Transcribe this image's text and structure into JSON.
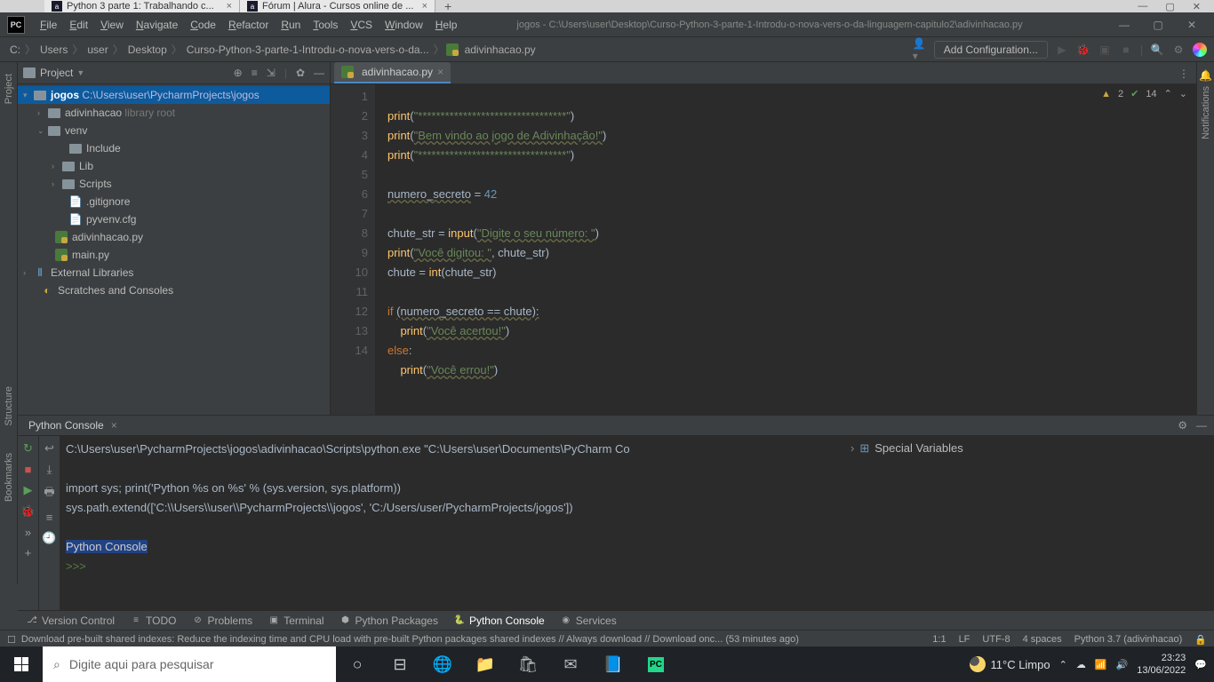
{
  "browserTabs": [
    {
      "icon": "a",
      "title": "Python 3 parte 1: Trabalhando c..."
    },
    {
      "icon": "a",
      "title": "Fórum | Alura - Cursos online de ..."
    }
  ],
  "menu": [
    "File",
    "Edit",
    "View",
    "Navigate",
    "Code",
    "Refactor",
    "Run",
    "Tools",
    "VCS",
    "Window",
    "Help"
  ],
  "windowTitle": "jogos - C:\\Users\\user\\Desktop\\Curso-Python-3-parte-1-Introdu-o-nova-vers-o-da-linguagem-capitulo2\\adivinhacao.py",
  "breadcrumbs": [
    "C:",
    "Users",
    "user",
    "Desktop",
    "Curso-Python-3-parte-1-Introdu-o-nova-vers-o-da..."
  ],
  "breadcrumbFile": "adivinhacao.py",
  "addConfig": "Add Configuration...",
  "projectPanel": {
    "title": "Project",
    "root": {
      "name": "jogos",
      "path": "C:\\Users\\user\\PycharmProjects\\jogos"
    },
    "items": [
      {
        "indent": 1,
        "chev": ">",
        "icon": "folder",
        "name": "adivinhacao",
        "suffix": "library root"
      },
      {
        "indent": 1,
        "chev": "v",
        "icon": "folder",
        "name": "venv"
      },
      {
        "indent": 2,
        "chev": "",
        "icon": "folder",
        "name": "Include"
      },
      {
        "indent": 2,
        "chev": ">",
        "icon": "folder",
        "name": "Lib"
      },
      {
        "indent": 2,
        "chev": ">",
        "icon": "folder",
        "name": "Scripts"
      },
      {
        "indent": 2,
        "chev": "",
        "icon": "file",
        "name": ".gitignore"
      },
      {
        "indent": 2,
        "chev": "",
        "icon": "file",
        "name": "pyvenv.cfg"
      },
      {
        "indent": 1,
        "chev": "",
        "icon": "py",
        "name": "adivinhacao.py"
      },
      {
        "indent": 1,
        "chev": "",
        "icon": "py",
        "name": "main.py"
      }
    ],
    "extLib": "External Libraries",
    "scratches": "Scratches and Consoles"
  },
  "editor": {
    "tabName": "adivinhacao.py",
    "warnings": "2",
    "hints": "14",
    "lines": 14
  },
  "code": {
    "l1a": "print",
    "l1b": "(",
    "l1c": "\"*********************************\"",
    "l1d": ")",
    "l2a": "print",
    "l2b": "(",
    "l2c": "\"Bem vindo ao jogo de Adivinhação!\"",
    "l2d": ")",
    "l3a": "print",
    "l3b": "(",
    "l3c": "\"*********************************\"",
    "l3d": ")",
    "l5a": "numero_secreto",
    "l5b": " = ",
    "l5c": "42",
    "l7a": "chute_str = ",
    "l7b": "input",
    "l7c": "(",
    "l7d": "\"Digite o seu número: \"",
    "l7e": ")",
    "l8a": "print",
    "l8b": "(",
    "l8c": "\"Você digitou: \"",
    "l8d": ", chute_str)",
    "l9a": "chute = ",
    "l9b": "int",
    "l9c": "(chute_str)",
    "l11a": "if ",
    "l11b": "(numero_secreto == chute):",
    "l12a": "    print",
    "l12b": "(",
    "l12c": "\"Você acertou!\"",
    "l12d": ")",
    "l13a": "else",
    "l14a": "    print",
    "l14b": "(",
    "l14c": "\"Você errou!\"",
    "l14d": ")"
  },
  "console": {
    "title": "Python Console",
    "line1": "C:\\Users\\user\\PycharmProjects\\jogos\\adivinhacao\\Scripts\\python.exe \"C:\\Users\\user\\Documents\\PyCharm Co",
    "line2": "import sys; print('Python %s on %s' % (sys.version, sys.platform))",
    "line3": "sys.path.extend(['C:\\\\Users\\\\user\\\\PycharmProjects\\\\jogos', 'C:/Users/user/PycharmProjects/jogos'])",
    "line4": "Python Console",
    "prompt": ">>>",
    "specialVars": "Special Variables"
  },
  "bottomTools": [
    "Version Control",
    "TODO",
    "Problems",
    "Terminal",
    "Python Packages",
    "Python Console",
    "Services"
  ],
  "statusMsg": "Download pre-built shared indexes: Reduce the indexing time and CPU load with pre-built Python packages shared indexes // Always download // Download onc... (53 minutes ago)",
  "statusRight": {
    "pos": "1:1",
    "lf": "LF",
    "enc": "UTF-8",
    "indent": "4 spaces",
    "python": "Python 3.7 (adivinhacao)"
  },
  "leftTabs": [
    "Structure",
    "Bookmarks"
  ],
  "rightTab": "Notifications",
  "taskbar": {
    "search": "Digite aqui para pesquisar",
    "weather": "11°C  Limpo",
    "time": "23:23",
    "date": "13/06/2022"
  }
}
